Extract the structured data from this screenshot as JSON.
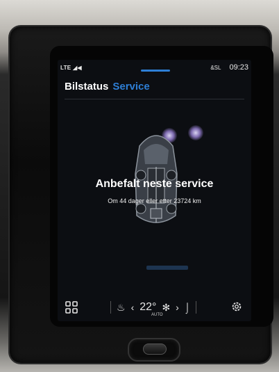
{
  "status_bar": {
    "signal": "LTE",
    "profile": "&SL",
    "time": "09:23"
  },
  "tabs": [
    {
      "label": "Bilstatus",
      "active": false
    },
    {
      "label": "Service",
      "active": true
    }
  ],
  "service": {
    "title": "Anbefalt neste service",
    "detail": "Om 44 dager eller etter 23724 km"
  },
  "climate": {
    "temperature": "22°",
    "mode": "AUTO"
  },
  "colors": {
    "accent": "#2e7fd6",
    "screen_bg": "#0c0e12"
  },
  "icons": [
    "apps-grid-icon",
    "seat-heat-icon",
    "chevron-left-icon",
    "fan-icon",
    "chevron-right-icon",
    "seat-icon",
    "settings-gear-icon"
  ]
}
